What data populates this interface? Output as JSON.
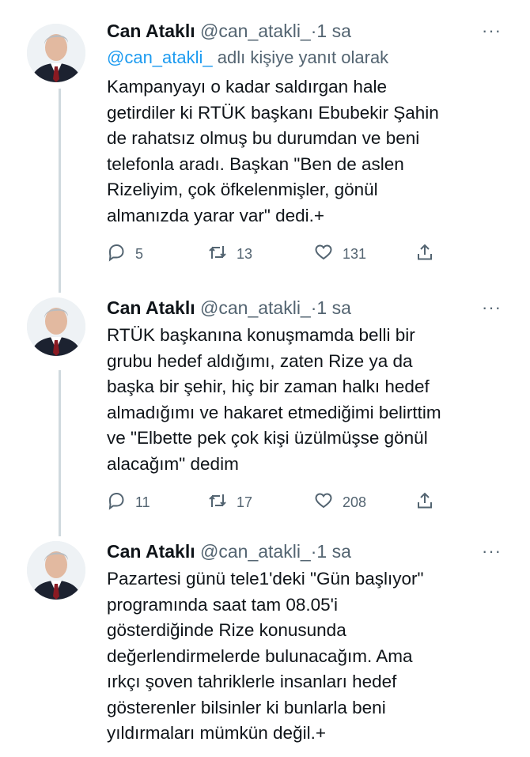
{
  "tweets": [
    {
      "name": "Can Ataklı",
      "handle": "@can_atakli_",
      "separator": "·",
      "time": "1 sa",
      "more": "···",
      "reply_to_mention": "@can_atakli_",
      "reply_to_suffix": " adlı kişiye yanıt olarak",
      "text": "Kampanyayı o kadar saldırgan hale\ngetirdiler ki RTÜK başkanı Ebubekir Şahin\nde rahatsız olmuş bu durumdan ve beni\ntelefonla aradı. Başkan \"Ben de aslen\nRizeliyim, çok öfkelenmişler, gönül\nalmanızda yarar var\" dedi.+",
      "replies": "5",
      "retweets": "13",
      "likes": "131"
    },
    {
      "name": "Can Ataklı",
      "handle": "@can_atakli_",
      "separator": "·",
      "time": "1 sa",
      "more": "···",
      "text": "RTÜK başkanına konuşmamda belli bir\ngrubu hedef aldığımı, zaten Rize ya da\nbaşka bir şehir, hiç bir zaman halkı hedef\nalmadığımı ve hakaret etmediğimi belirttim\nve \"Elbette pek çok kişi üzülmüşse gönül\nalacağım\" dedim",
      "replies": "11",
      "retweets": "17",
      "likes": "208"
    },
    {
      "name": "Can Ataklı",
      "handle": "@can_atakli_",
      "separator": "·",
      "time": "1 sa",
      "more": "···",
      "text": "Pazartesi günü tele1'deki \"Gün başlıyor\"\nprogramında saat tam 08.05'i\ngösterdiğinde Rize konusunda\ndeğerlendirmelerde bulunacağım. Ama\nırkçı şoven tahriklerle insanları hedef\ngösterenler bilsinler ki bunlarla beni\nyıldırmaları mümkün değil.+"
    }
  ],
  "icons": {
    "reply": "reply-icon",
    "retweet": "retweet-icon",
    "like": "heart-icon",
    "share": "share-icon"
  },
  "colors": {
    "text": "#0f1419",
    "secondary": "#536471",
    "mention": "#1d9bf0",
    "thread_line": "#cfd9de"
  }
}
